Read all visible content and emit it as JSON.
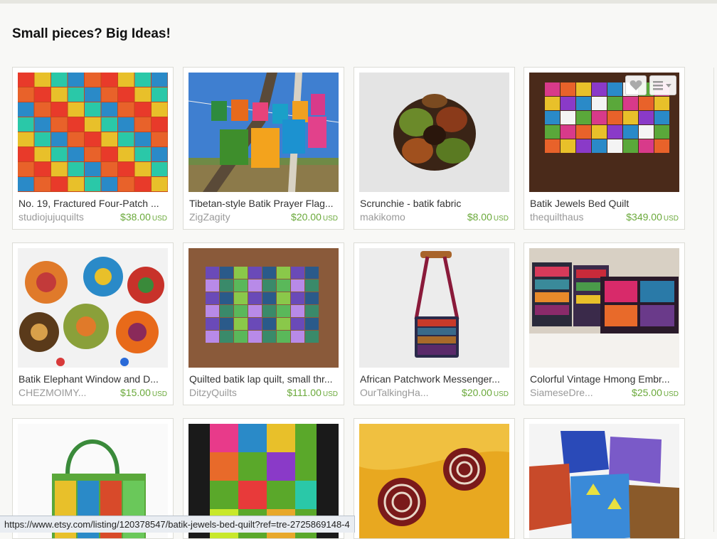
{
  "section": {
    "heading": "Small pieces? Big Ideas!"
  },
  "status_bar": {
    "url": "https://www.etsy.com/listing/120378547/batik-jewels-bed-quilt?ref=tre-2725869148-4"
  },
  "currency": "USD",
  "colors": {
    "price": "#6aa93a",
    "shop": "#999999",
    "title": "#333333"
  },
  "hover_actions": {
    "favorite_icon": "heart-icon",
    "menu_icon": "list-menu-icon"
  },
  "listings": [
    {
      "title": "No. 19, Fractured Four-Patch ...",
      "shop": "studiojujuquilts",
      "price": "$38.00",
      "image": "colorful-patchwork-quilt"
    },
    {
      "title": "Tibetan-style Batik Prayer Flag...",
      "shop": "ZigZagity",
      "price": "$20.00",
      "image": "prayer-flags-on-tree"
    },
    {
      "title": "Scrunchie - batik fabric",
      "shop": "makikomo",
      "price": "$8.00",
      "image": "batik-scrunchie"
    },
    {
      "title": "Batik Jewels Bed Quilt",
      "shop": "thequilthaus",
      "price": "$349.00",
      "image": "bed-quilt"
    },
    {
      "title": "Batik Elephant Window and D...",
      "shop": "CHEZMOIMY...",
      "price": "$15.00",
      "image": "batik-elephants"
    },
    {
      "title": "Quilted batik lap quilt, small thr...",
      "shop": "DitzyQuilts",
      "price": "$111.00",
      "image": "lap-quilt"
    },
    {
      "title": "African Patchwork Messenger...",
      "shop": "OurTalkingHa...",
      "price": "$20.00",
      "image": "messenger-bag"
    },
    {
      "title": "Colorful Vintage Hmong Embr...",
      "shop": "SiameseDre...",
      "price": "$25.00",
      "image": "hmong-pillows"
    },
    {
      "title": "",
      "shop": "",
      "price": "",
      "image": "tote-bag"
    },
    {
      "title": "",
      "shop": "",
      "price": "",
      "image": "patchwork-dress"
    },
    {
      "title": "",
      "shop": "",
      "price": "",
      "image": "spiral-earrings"
    },
    {
      "title": "",
      "shop": "",
      "price": "",
      "image": "fabric-cubes"
    }
  ]
}
